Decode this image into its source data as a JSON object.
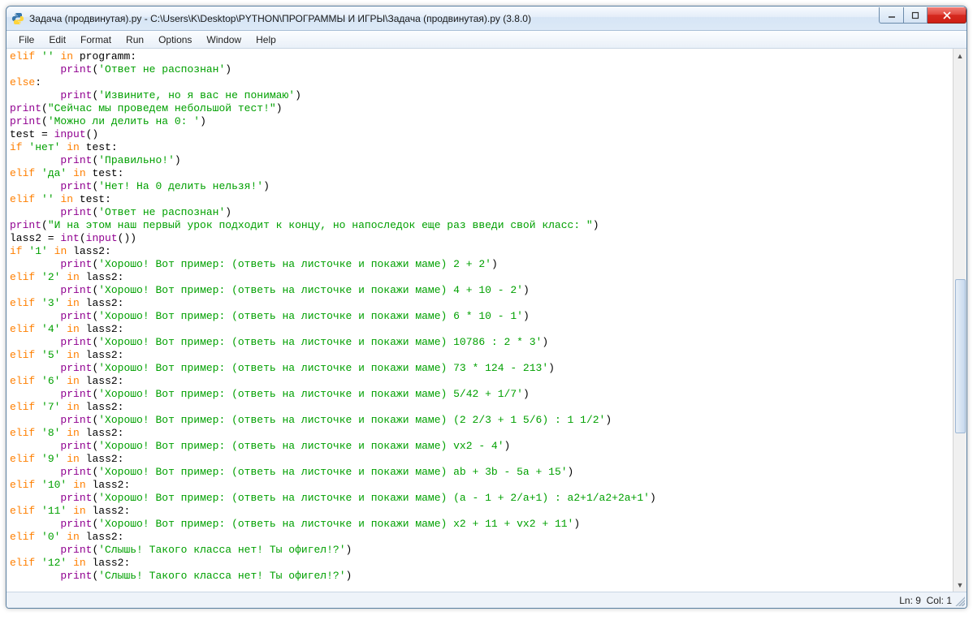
{
  "window": {
    "title": "Задача (продвинутая).py - C:\\Users\\K\\Desktop\\PYTHON\\ПРОГРАММЫ И ИГРЫ\\Задача (продвинутая).py (3.8.0)"
  },
  "menu": {
    "file": "File",
    "edit": "Edit",
    "format": "Format",
    "run": "Run",
    "options": "Options",
    "window": "Window",
    "help": "Help"
  },
  "status": {
    "ln_label": "Ln:",
    "ln": "9",
    "col_label": "Col:",
    "col": "1"
  },
  "code": {
    "lines": [
      [
        [
          "kw",
          "elif"
        ],
        [
          "op",
          " "
        ],
        [
          "str",
          "''"
        ],
        [
          "op",
          " "
        ],
        [
          "kw",
          "in"
        ],
        [
          "op",
          " programm:"
        ]
      ],
      [
        [
          "op",
          "        "
        ],
        [
          "builtin",
          "print"
        ],
        [
          "op",
          "("
        ],
        [
          "str",
          "'Ответ не распознан'"
        ],
        [
          "op",
          ")"
        ]
      ],
      [
        [
          "kw",
          "else"
        ],
        [
          "op",
          ":"
        ]
      ],
      [
        [
          "op",
          "        "
        ],
        [
          "builtin",
          "print"
        ],
        [
          "op",
          "("
        ],
        [
          "str",
          "'Извините, но я вас не понимаю'"
        ],
        [
          "op",
          ")"
        ]
      ],
      [
        [
          "builtin",
          "print"
        ],
        [
          "op",
          "("
        ],
        [
          "str",
          "\"Сейчас мы проведем небольшой тест!\""
        ],
        [
          "op",
          ")"
        ]
      ],
      [
        [
          "builtin",
          "print"
        ],
        [
          "op",
          "("
        ],
        [
          "str",
          "'Можно ли делить на 0: '"
        ],
        [
          "op",
          ")"
        ]
      ],
      [
        [
          "op",
          "test = "
        ],
        [
          "builtin",
          "input"
        ],
        [
          "op",
          "()"
        ]
      ],
      [
        [
          "kw",
          "if"
        ],
        [
          "op",
          " "
        ],
        [
          "str",
          "'нет'"
        ],
        [
          "op",
          " "
        ],
        [
          "kw",
          "in"
        ],
        [
          "op",
          " test:"
        ]
      ],
      [
        [
          "op",
          "        "
        ],
        [
          "builtin",
          "print"
        ],
        [
          "op",
          "("
        ],
        [
          "str",
          "'Правильно!'"
        ],
        [
          "op",
          ")"
        ]
      ],
      [
        [
          "kw",
          "elif"
        ],
        [
          "op",
          " "
        ],
        [
          "str",
          "'да'"
        ],
        [
          "op",
          " "
        ],
        [
          "kw",
          "in"
        ],
        [
          "op",
          " test:"
        ]
      ],
      [
        [
          "op",
          "        "
        ],
        [
          "builtin",
          "print"
        ],
        [
          "op",
          "("
        ],
        [
          "str",
          "'Нет! На 0 делить нельзя!'"
        ],
        [
          "op",
          ")"
        ]
      ],
      [
        [
          "kw",
          "elif"
        ],
        [
          "op",
          " "
        ],
        [
          "str",
          "''"
        ],
        [
          "op",
          " "
        ],
        [
          "kw",
          "in"
        ],
        [
          "op",
          " test:"
        ]
      ],
      [
        [
          "op",
          "        "
        ],
        [
          "builtin",
          "print"
        ],
        [
          "op",
          "("
        ],
        [
          "str",
          "'Ответ не распознан'"
        ],
        [
          "op",
          ")"
        ]
      ],
      [
        [
          "builtin",
          "print"
        ],
        [
          "op",
          "("
        ],
        [
          "str",
          "\"И на этом наш первый урок подходит к концу, но напоследок еще раз введи свой класс: \""
        ],
        [
          "op",
          ")"
        ]
      ],
      [
        [
          "op",
          "lass2 = "
        ],
        [
          "builtin",
          "int"
        ],
        [
          "op",
          "("
        ],
        [
          "builtin",
          "input"
        ],
        [
          "op",
          "())"
        ]
      ],
      [
        [
          "kw",
          "if"
        ],
        [
          "op",
          " "
        ],
        [
          "str",
          "'1'"
        ],
        [
          "op",
          " "
        ],
        [
          "kw",
          "in"
        ],
        [
          "op",
          " lass2:"
        ]
      ],
      [
        [
          "op",
          "        "
        ],
        [
          "builtin",
          "print"
        ],
        [
          "op",
          "("
        ],
        [
          "str",
          "'Хорошо! Вот пример: (ответь на листочке и покажи маме) 2 + 2'"
        ],
        [
          "op",
          ")"
        ]
      ],
      [
        [
          "kw",
          "elif"
        ],
        [
          "op",
          " "
        ],
        [
          "str",
          "'2'"
        ],
        [
          "op",
          " "
        ],
        [
          "kw",
          "in"
        ],
        [
          "op",
          " lass2:"
        ]
      ],
      [
        [
          "op",
          "        "
        ],
        [
          "builtin",
          "print"
        ],
        [
          "op",
          "("
        ],
        [
          "str",
          "'Хорошо! Вот пример: (ответь на листочке и покажи маме) 4 + 10 - 2'"
        ],
        [
          "op",
          ")"
        ]
      ],
      [
        [
          "kw",
          "elif"
        ],
        [
          "op",
          " "
        ],
        [
          "str",
          "'3'"
        ],
        [
          "op",
          " "
        ],
        [
          "kw",
          "in"
        ],
        [
          "op",
          " lass2:"
        ]
      ],
      [
        [
          "op",
          "        "
        ],
        [
          "builtin",
          "print"
        ],
        [
          "op",
          "("
        ],
        [
          "str",
          "'Хорошо! Вот пример: (ответь на листочке и покажи маме) 6 * 10 - 1'"
        ],
        [
          "op",
          ")"
        ]
      ],
      [
        [
          "kw",
          "elif"
        ],
        [
          "op",
          " "
        ],
        [
          "str",
          "'4'"
        ],
        [
          "op",
          " "
        ],
        [
          "kw",
          "in"
        ],
        [
          "op",
          " lass2:"
        ]
      ],
      [
        [
          "op",
          "        "
        ],
        [
          "builtin",
          "print"
        ],
        [
          "op",
          "("
        ],
        [
          "str",
          "'Хорошо! Вот пример: (ответь на листочке и покажи маме) 10786 : 2 * 3'"
        ],
        [
          "op",
          ")"
        ]
      ],
      [
        [
          "kw",
          "elif"
        ],
        [
          "op",
          " "
        ],
        [
          "str",
          "'5'"
        ],
        [
          "op",
          " "
        ],
        [
          "kw",
          "in"
        ],
        [
          "op",
          " lass2:"
        ]
      ],
      [
        [
          "op",
          "        "
        ],
        [
          "builtin",
          "print"
        ],
        [
          "op",
          "("
        ],
        [
          "str",
          "'Хорошо! Вот пример: (ответь на листочке и покажи маме) 73 * 124 - 213'"
        ],
        [
          "op",
          ")"
        ]
      ],
      [
        [
          "kw",
          "elif"
        ],
        [
          "op",
          " "
        ],
        [
          "str",
          "'6'"
        ],
        [
          "op",
          " "
        ],
        [
          "kw",
          "in"
        ],
        [
          "op",
          " lass2:"
        ]
      ],
      [
        [
          "op",
          "        "
        ],
        [
          "builtin",
          "print"
        ],
        [
          "op",
          "("
        ],
        [
          "str",
          "'Хорошо! Вот пример: (ответь на листочке и покажи маме) 5/42 + 1/7'"
        ],
        [
          "op",
          ")"
        ]
      ],
      [
        [
          "kw",
          "elif"
        ],
        [
          "op",
          " "
        ],
        [
          "str",
          "'7'"
        ],
        [
          "op",
          " "
        ],
        [
          "kw",
          "in"
        ],
        [
          "op",
          " lass2:"
        ]
      ],
      [
        [
          "op",
          "        "
        ],
        [
          "builtin",
          "print"
        ],
        [
          "op",
          "("
        ],
        [
          "str",
          "'Хорошо! Вот пример: (ответь на листочке и покажи маме) (2 2/3 + 1 5/6) : 1 1/2'"
        ],
        [
          "op",
          ")"
        ]
      ],
      [
        [
          "kw",
          "elif"
        ],
        [
          "op",
          " "
        ],
        [
          "str",
          "'8'"
        ],
        [
          "op",
          " "
        ],
        [
          "kw",
          "in"
        ],
        [
          "op",
          " lass2:"
        ]
      ],
      [
        [
          "op",
          "        "
        ],
        [
          "builtin",
          "print"
        ],
        [
          "op",
          "("
        ],
        [
          "str",
          "'Хорошо! Вот пример: (ответь на листочке и покажи маме) vx2 - 4'"
        ],
        [
          "op",
          ")"
        ]
      ],
      [
        [
          "kw",
          "elif"
        ],
        [
          "op",
          " "
        ],
        [
          "str",
          "'9'"
        ],
        [
          "op",
          " "
        ],
        [
          "kw",
          "in"
        ],
        [
          "op",
          " lass2:"
        ]
      ],
      [
        [
          "op",
          "        "
        ],
        [
          "builtin",
          "print"
        ],
        [
          "op",
          "("
        ],
        [
          "str",
          "'Хорошо! Вот пример: (ответь на листочке и покажи маме) ab + 3b - 5a + 15'"
        ],
        [
          "op",
          ")"
        ]
      ],
      [
        [
          "kw",
          "elif"
        ],
        [
          "op",
          " "
        ],
        [
          "str",
          "'10'"
        ],
        [
          "op",
          " "
        ],
        [
          "kw",
          "in"
        ],
        [
          "op",
          " lass2:"
        ]
      ],
      [
        [
          "op",
          "        "
        ],
        [
          "builtin",
          "print"
        ],
        [
          "op",
          "("
        ],
        [
          "str",
          "'Хорошо! Вот пример: (ответь на листочке и покажи маме) (a - 1 + 2/a+1) : a2+1/a2+2a+1'"
        ],
        [
          "op",
          ")"
        ]
      ],
      [
        [
          "kw",
          "elif"
        ],
        [
          "op",
          " "
        ],
        [
          "str",
          "'11'"
        ],
        [
          "op",
          " "
        ],
        [
          "kw",
          "in"
        ],
        [
          "op",
          " lass2:"
        ]
      ],
      [
        [
          "op",
          "        "
        ],
        [
          "builtin",
          "print"
        ],
        [
          "op",
          "("
        ],
        [
          "str",
          "'Хорошо! Вот пример: (ответь на листочке и покажи маме) x2 + 11 + vx2 + 11'"
        ],
        [
          "op",
          ")"
        ]
      ],
      [
        [
          "kw",
          "elif"
        ],
        [
          "op",
          " "
        ],
        [
          "str",
          "'0'"
        ],
        [
          "op",
          " "
        ],
        [
          "kw",
          "in"
        ],
        [
          "op",
          " lass2:"
        ]
      ],
      [
        [
          "op",
          "        "
        ],
        [
          "builtin",
          "print"
        ],
        [
          "op",
          "("
        ],
        [
          "str",
          "'Слышь! Такого класса нет! Ты офигел!?'"
        ],
        [
          "op",
          ")"
        ]
      ],
      [
        [
          "kw",
          "elif"
        ],
        [
          "op",
          " "
        ],
        [
          "str",
          "'12'"
        ],
        [
          "op",
          " "
        ],
        [
          "kw",
          "in"
        ],
        [
          "op",
          " lass2:"
        ]
      ],
      [
        [
          "op",
          "        "
        ],
        [
          "builtin",
          "print"
        ],
        [
          "op",
          "("
        ],
        [
          "str",
          "'Слышь! Такого класса нет! Ты офигел!?'"
        ],
        [
          "op",
          ")"
        ]
      ]
    ]
  },
  "scrollbar": {
    "thumb_top_pct": 42,
    "thumb_height_pct": 30
  }
}
